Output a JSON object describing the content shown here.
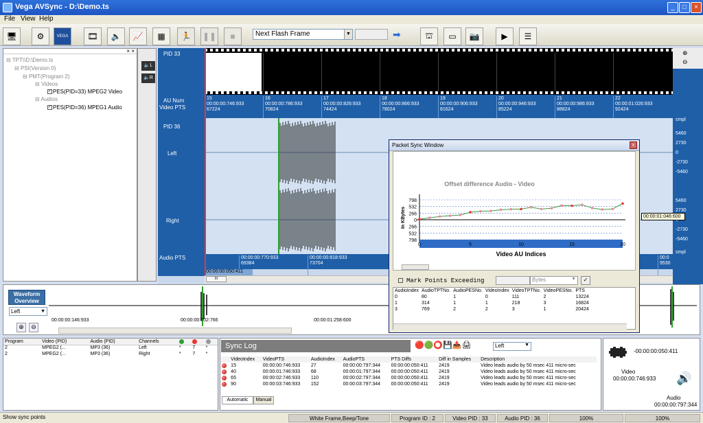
{
  "window": {
    "title": "Vega AVSync - D:\\Demo.ts"
  },
  "menu": [
    "File",
    "View",
    "Help"
  ],
  "toolbar": {
    "flash_select": "Next Flash Frame"
  },
  "tree": {
    "nodes": [
      "TPT\\\\D:\\Demo.ts",
      "PSI(Version 0)",
      "PMT(Program 2)",
      "Videos",
      "PES(PID=33) MPEG2 Video",
      "Audios",
      "PES(PID=36) MPEG1 Audio"
    ]
  },
  "audio_ctrl": {
    "left": "L",
    "right": "R"
  },
  "display": {
    "video_pid": "PID 33",
    "au_num_label": "AU Num",
    "video_pts_label": "Video PTS",
    "audio_pid": "PID 36",
    "left_label": "Left",
    "right_label": "Right",
    "audio_pts_label": "Audio PTS",
    "video_frames": [
      {
        "au": "15",
        "pts": "00:00:00:746:933",
        "n": "67224"
      },
      {
        "au": "16",
        "pts": "00:00:00:786:933",
        "n": "70824"
      },
      {
        "au": "17",
        "pts": "00:00:00:826:933",
        "n": "74424"
      },
      {
        "au": "18",
        "pts": "00:00:00:866:933",
        "n": "78024"
      },
      {
        "au": "19",
        "pts": "00:00:00:906:933",
        "n": "81624"
      },
      {
        "au": "20",
        "pts": "00:00:00:946:933",
        "n": "85224"
      },
      {
        "au": "21",
        "pts": "00:00:00:986:933",
        "n": "88824"
      },
      {
        "au": "22",
        "pts": "00:00:01:026:933",
        "n": "92424"
      }
    ],
    "audio_pts": [
      {
        "pts": "00:00:00:770:933",
        "n": "69384"
      },
      {
        "pts": "00:00:00:818:933",
        "n": "73704"
      }
    ],
    "audio_pts_partial": {
      "pts": "00:0",
      "n": "9530"
    },
    "offset_value": "00:00:00:050:411",
    "scale_top": [
      "5460",
      "2730",
      "0",
      "-2730",
      "-5460"
    ],
    "scale_bot": [
      "5460",
      "2730",
      "0",
      "-2730",
      "-5460"
    ],
    "scale_unit": "smpl",
    "tooltip": "00:00:01:046:600"
  },
  "overview": {
    "label": "Waveform Overview",
    "channel": "Left",
    "t1": "00:00:00:146:933",
    "t2": "00:00:00:702:766",
    "t3": "00:00:01:258:600"
  },
  "psw": {
    "title": "Packet Sync Window",
    "mark_label": "Mark Points Exceeding",
    "unit": "Bytes",
    "columns": [
      "AudioIndex",
      "AudioTPTNo.",
      "AudioPESNo.",
      "VideoIndex",
      "VideoTPTNo.",
      "VideoPESNo.",
      "PTS"
    ],
    "rows": [
      [
        "0",
        "80",
        "1",
        "0",
        "111",
        "2",
        "13224"
      ],
      [
        "1",
        "314",
        "1",
        "1",
        "218",
        "3",
        "16824"
      ],
      [
        "3",
        "769",
        "2",
        "2",
        "3",
        "1",
        "20424"
      ]
    ]
  },
  "chart_data": {
    "type": "line",
    "title": "Offset difference Audio - Video",
    "xlabel": "Video AU Indices",
    "ylabel": "In KBytes",
    "x_ticks": [
      "0",
      "5",
      "10",
      "15",
      "20"
    ],
    "y_ticks": [
      "798",
      "532",
      "266",
      "0",
      "266",
      "532",
      "798"
    ],
    "ylim": [
      -798,
      798
    ],
    "x": [
      0,
      1,
      2,
      3,
      4,
      5,
      6,
      7,
      8,
      9,
      10,
      11,
      12,
      13,
      14,
      15,
      16,
      17,
      18,
      19,
      20
    ],
    "values": [
      20,
      80,
      130,
      160,
      190,
      300,
      340,
      350,
      400,
      420,
      430,
      500,
      430,
      460,
      570,
      560,
      600,
      470,
      410,
      430,
      650
    ]
  },
  "params": {
    "columns": [
      "Program",
      "Video (PID)",
      "Audio (PID)",
      "Channels"
    ],
    "rows": [
      [
        "2",
        "MPEG2 (...",
        "MP3 (36)",
        "Left",
        "*",
        "7",
        "*"
      ],
      [
        "2",
        "MPEG2 (...",
        "MP3 (36)",
        "Right",
        "*",
        "7",
        "*"
      ]
    ]
  },
  "synclog": {
    "title": "Sync Log",
    "channel": "Left",
    "columns": [
      "VideoIndex",
      "VideoPTS",
      "AudioIndex",
      "AudioPTS",
      "PTS Diffs",
      "Diff in Samples",
      "Description"
    ],
    "rows": [
      [
        "15",
        "00:00:00:746:933",
        "27",
        "00:00:00:797:344",
        "00:00:00:050:411",
        "2419",
        "Video leads audio by 50 msec 411 micro-sec"
      ],
      [
        "40",
        "00:00:01:746:933",
        "68",
        "00:00:01:797:344",
        "00:00:00:050:411",
        "2419",
        "Video leads audio by 50 msec 411 micro-sec"
      ],
      [
        "65",
        "00:00:02:746:933",
        "110",
        "00:00:02:797:344",
        "00:00:00:050:411",
        "2419",
        "Video leads audio by 50 msec 411 micro-sec"
      ],
      [
        "90",
        "00:00:03:746:933",
        "152",
        "00:00:03:797:344",
        "00:00:00:050:411",
        "2419",
        "Video leads audio by 50 msec 411 micro-sec"
      ]
    ],
    "tabs": [
      "Automatic",
      "Manual"
    ]
  },
  "vinfo": {
    "offset": "-00:00:00:050:411",
    "video_label": "Video",
    "video_pts": "00:00:00:746:933",
    "audio_label": "Audio",
    "audio_pts": "00:00:00:797:344"
  },
  "status": {
    "left": "Show sync points",
    "c1": "White Frame,Beep/Tone",
    "c2": "Program ID : 2",
    "c3": "Video PID : 33",
    "c4": "Audio PID : 36",
    "c5": "100%",
    "c6": "100%"
  }
}
